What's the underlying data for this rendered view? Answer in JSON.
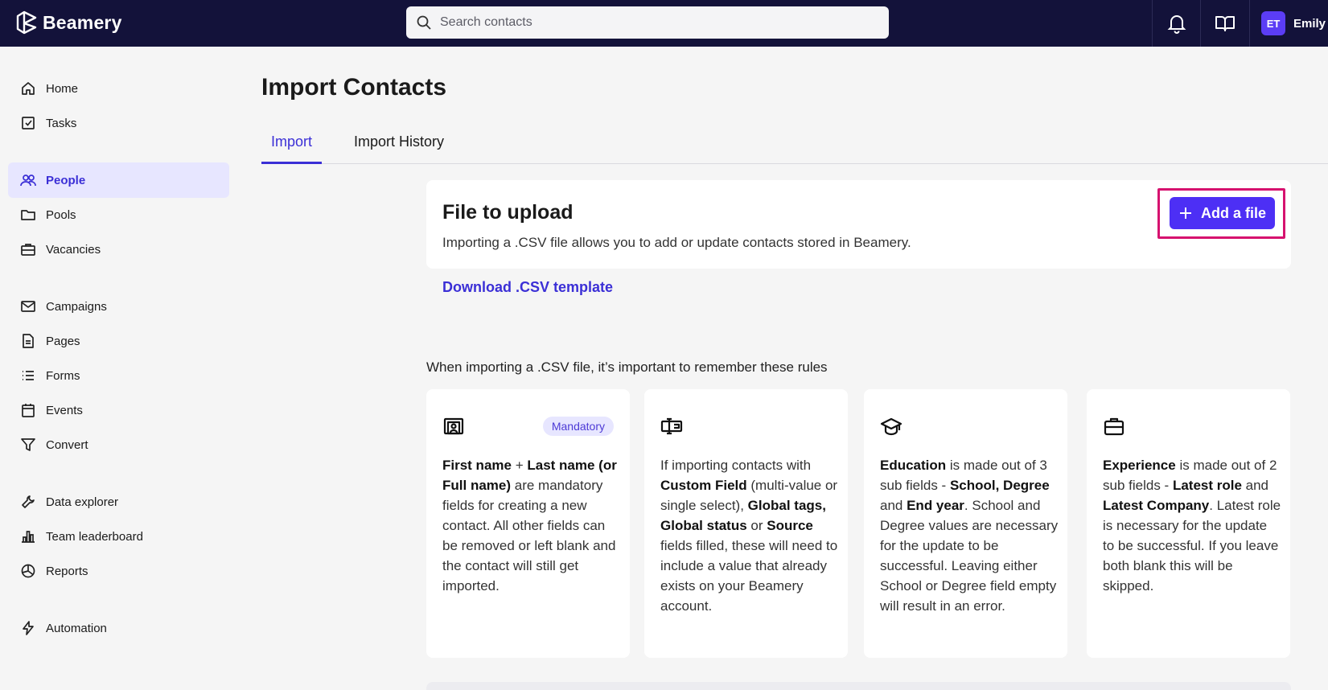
{
  "app": {
    "logo_text": "Beamery",
    "search_placeholder": "Search contacts",
    "user_initials": "ET",
    "user_name": "Emily T"
  },
  "sidebar": {
    "items": [
      {
        "label": "Home",
        "icon": "home-icon"
      },
      {
        "label": "Tasks",
        "icon": "tasks-icon"
      },
      {
        "label": "People",
        "icon": "people-icon",
        "active": true
      },
      {
        "label": "Pools",
        "icon": "folder-icon"
      },
      {
        "label": "Vacancies",
        "icon": "briefcase-icon"
      },
      {
        "label": "Campaigns",
        "icon": "mail-icon"
      },
      {
        "label": "Pages",
        "icon": "page-icon"
      },
      {
        "label": "Forms",
        "icon": "list-icon"
      },
      {
        "label": "Events",
        "icon": "calendar-icon"
      },
      {
        "label": "Convert",
        "icon": "funnel-icon"
      },
      {
        "label": "Data explorer",
        "icon": "wrench-icon"
      },
      {
        "label": "Team leaderboard",
        "icon": "bar-chart-icon"
      },
      {
        "label": "Reports",
        "icon": "pie-chart-icon"
      },
      {
        "label": "Automation",
        "icon": "lightning-icon"
      }
    ]
  },
  "main": {
    "title": "Import Contacts",
    "tabs": [
      {
        "label": "Import",
        "active": true
      },
      {
        "label": "Import History"
      }
    ],
    "upload": {
      "title": "File to upload",
      "description": "Importing a .CSV file allows you to add or update contacts stored in Beamery.",
      "button_label": "Add a file",
      "download_link": "Download .CSV template"
    },
    "rules_intro": "When importing a .CSV file, it’s important to remember these rules",
    "badge": "Mandatory",
    "rules": [
      {
        "icon": "id-card-icon",
        "b1": "First name",
        "t1": " + ",
        "b2": "Last name (or Full name)",
        "t2": " are mandatory fields for creating a new contact. All other fields can be removed or left blank and the contact will still get imported."
      },
      {
        "icon": "custom-field-icon",
        "t0": "If importing contacts with ",
        "b1": "Custom Field",
        "t1": " (multi-value or single select), ",
        "b2": "Global tags, Global status",
        "t2": " or ",
        "b3": "Source",
        "t3": " fields filled, these will need to include a value that already exists on your Beamery account."
      },
      {
        "icon": "graduation-cap-icon",
        "b1": "Education",
        "t1": " is made out of 3 sub fields - ",
        "b2": "School, Degree",
        "t2": " and ",
        "b3": "End year",
        "t3": ". School and Degree values are necessary for the update to be successful. Leaving either School or Degree field empty will result in an error."
      },
      {
        "icon": "briefcase-icon",
        "b1": "Experience",
        "t1": " is made out of 2 sub fields - ",
        "b2": "Latest role",
        "t2": " and ",
        "b3": "Latest Company",
        "t3": ". Latest role is necessary for the update to be successful. If you leave both blank this will be skipped."
      }
    ]
  },
  "colors": {
    "topbar": "#13123a",
    "accent": "#4d2ff5",
    "highlight": "#d6126f"
  }
}
